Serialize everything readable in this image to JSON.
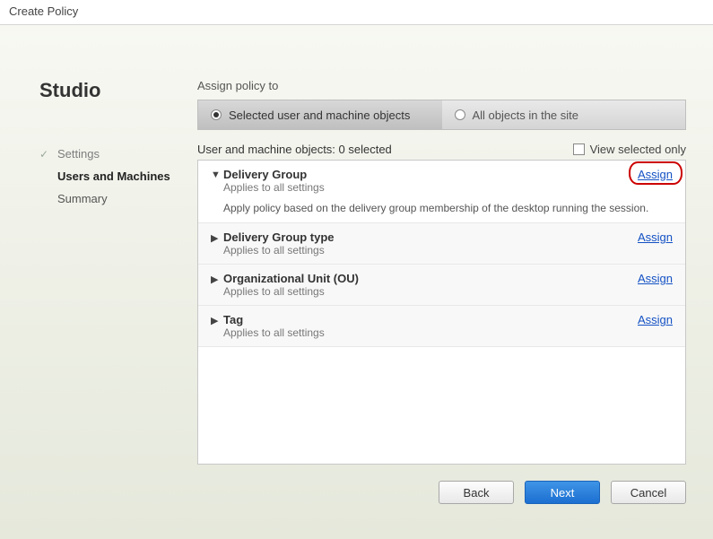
{
  "window": {
    "title": "Create Policy"
  },
  "sidebar": {
    "brand": "Studio",
    "steps": [
      {
        "label": "Settings",
        "state": "done"
      },
      {
        "label": "Users and Machines",
        "state": "current"
      },
      {
        "label": "Summary",
        "state": "pending"
      }
    ]
  },
  "content": {
    "sectionLabel": "Assign policy to",
    "scopeOptions": [
      {
        "label": "Selected user and machine objects",
        "selected": true
      },
      {
        "label": "All objects in the site",
        "selected": false
      }
    ],
    "listHeader": "User and machine objects: 0 selected",
    "viewSelectedOnly": {
      "label": "View selected only",
      "checked": false
    },
    "objects": [
      {
        "expanded": true,
        "title": "Delivery Group",
        "sub": "Applies to all settings",
        "desc": "Apply policy based on the delivery group membership of the desktop running the session.",
        "assignLabel": "Assign",
        "annotated": true
      },
      {
        "expanded": false,
        "title": "Delivery Group type",
        "sub": "Applies to all settings",
        "assignLabel": "Assign"
      },
      {
        "expanded": false,
        "title": "Organizational Unit (OU)",
        "sub": "Applies to all settings",
        "assignLabel": "Assign"
      },
      {
        "expanded": false,
        "title": "Tag",
        "sub": "Applies to all settings",
        "assignLabel": "Assign"
      }
    ]
  },
  "buttons": {
    "back": "Back",
    "next": "Next",
    "cancel": "Cancel"
  }
}
